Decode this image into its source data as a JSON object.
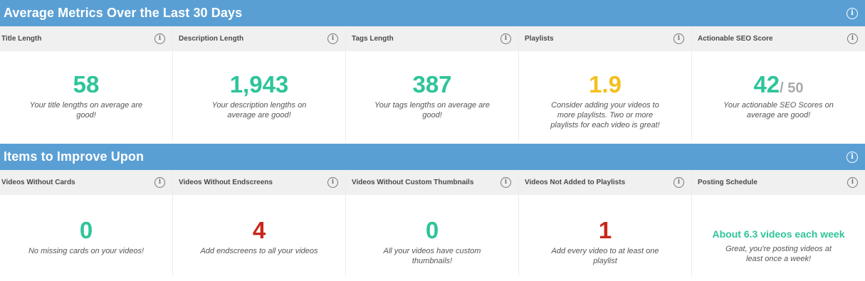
{
  "average_section": {
    "title": "Average Metrics Over the Last 30 Days",
    "cards": [
      {
        "label": "Title Length",
        "value": "58",
        "suffix": "",
        "status": "green",
        "desc": "Your title lengths on average are good!"
      },
      {
        "label": "Description Length",
        "value": "1,943",
        "suffix": "",
        "status": "green",
        "desc": "Your description lengths on average are good!"
      },
      {
        "label": "Tags Length",
        "value": "387",
        "suffix": "",
        "status": "green",
        "desc": "Your tags lengths on average are good!"
      },
      {
        "label": "Playlists",
        "value": "1.9",
        "suffix": "",
        "status": "yellow",
        "desc": "Consider adding your videos to more playlists. Two or more playlists for each video is great!"
      },
      {
        "label": "Actionable SEO Score",
        "value": "42",
        "suffix": "/ 50",
        "status": "green",
        "desc": "Your actionable SEO Scores on average are good!"
      }
    ]
  },
  "improve_section": {
    "title": "Items to Improve Upon",
    "cards": [
      {
        "label": "Videos Without Cards",
        "value": "0",
        "status": "green",
        "desc": "No missing cards on your videos!"
      },
      {
        "label": "Videos Without Endscreens",
        "value": "4",
        "status": "red",
        "desc": "Add endscreens to all your videos"
      },
      {
        "label": "Videos Without Custom Thumbnails",
        "value": "0",
        "status": "green",
        "desc": "All your videos have custom thumbnails!"
      },
      {
        "label": "Videos Not Added to Playlists",
        "value": "1",
        "status": "red",
        "desc": "Add every video to at least one playlist"
      },
      {
        "label": "Posting Schedule",
        "value": "About 6.3 videos each week",
        "status": "green",
        "desc": "Great, you're posting videos at least once a week!"
      }
    ]
  },
  "colors": {
    "header": "#5a9fd4",
    "green": "#2ec49a",
    "yellow": "#f4c01e",
    "red": "#c8271a"
  },
  "icons": {
    "info": "info-icon"
  }
}
